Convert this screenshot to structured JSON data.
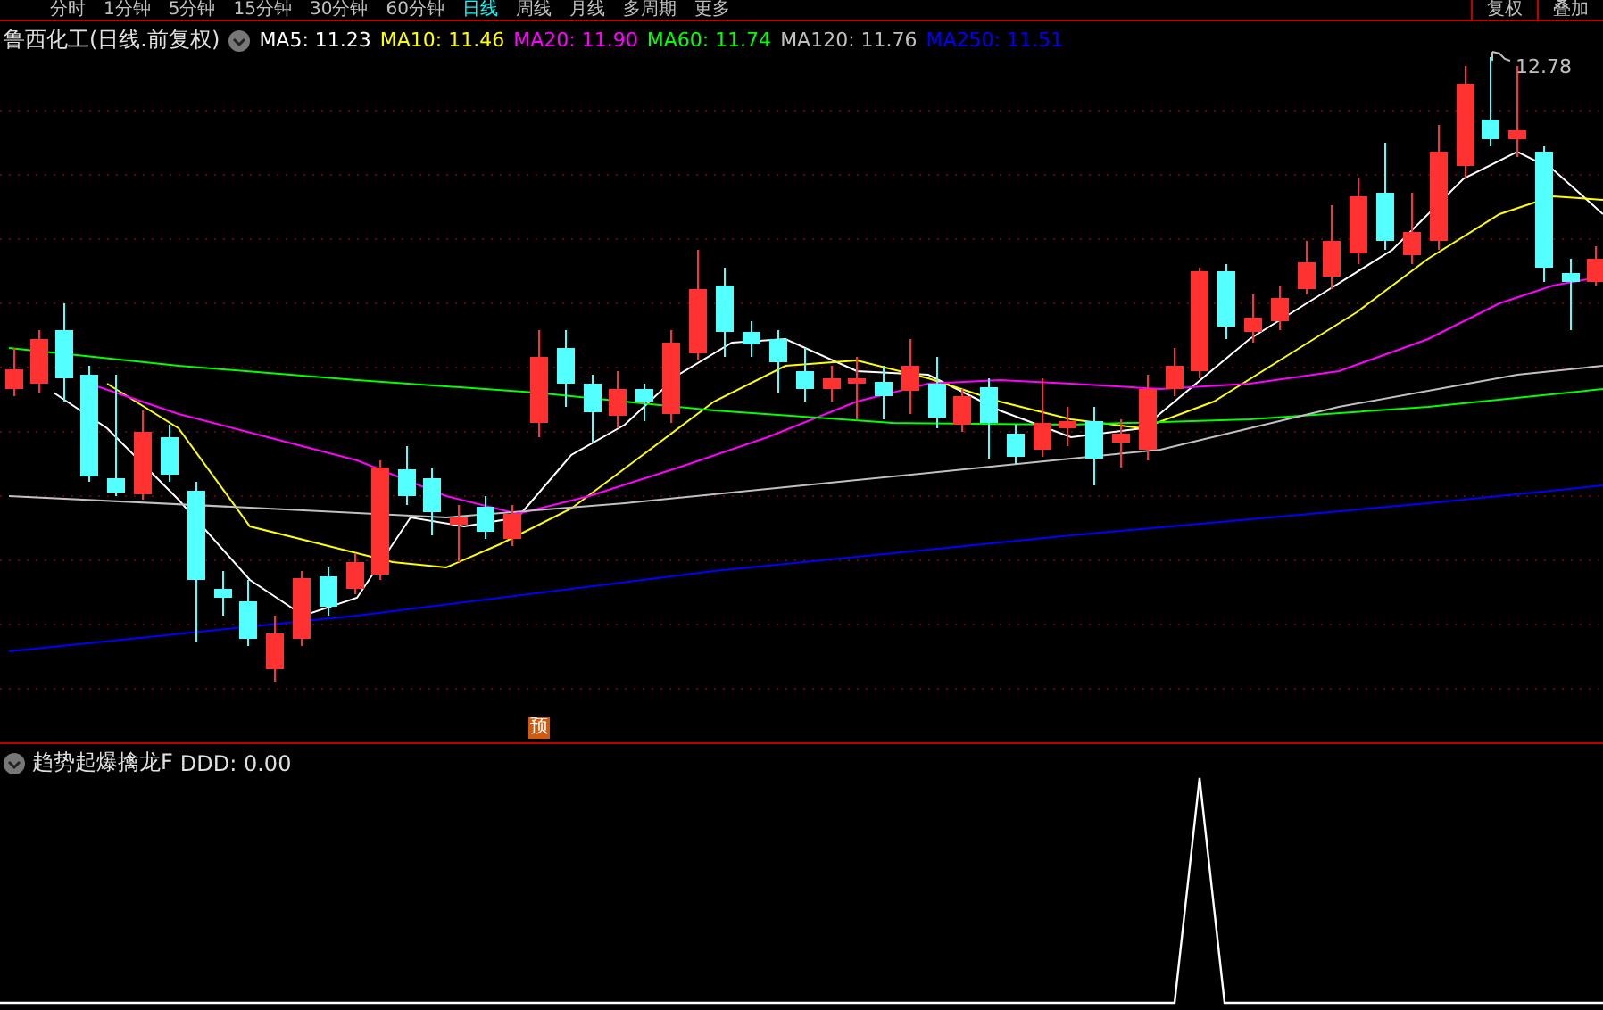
{
  "toolbar": {
    "tabs": [
      {
        "label": "分时",
        "selected": false
      },
      {
        "label": "1分钟",
        "selected": false
      },
      {
        "label": "5分钟",
        "selected": false
      },
      {
        "label": "15分钟",
        "selected": false
      },
      {
        "label": "30分钟",
        "selected": false
      },
      {
        "label": "60分钟",
        "selected": false
      },
      {
        "label": "日线",
        "selected": true
      },
      {
        "label": "周线",
        "selected": false
      },
      {
        "label": "月线",
        "selected": false
      },
      {
        "label": "多周期",
        "selected": false
      },
      {
        "label": "更多",
        "selected": false
      }
    ],
    "buttons": [
      "复权",
      "叠加"
    ]
  },
  "main_chart": {
    "title": "鲁西化工(日线.前复权)",
    "legend": [
      {
        "label": "MA5:",
        "value": "11.23",
        "color": "#ffffff"
      },
      {
        "label": "MA10:",
        "value": "11.46",
        "color": "#ffff00"
      },
      {
        "label": "MA20:",
        "value": "11.90",
        "color": "#ff00ff"
      },
      {
        "label": "MA60:",
        "value": "11.74",
        "color": "#00ff00"
      },
      {
        "label": "MA120:",
        "value": "11.76",
        "color": "#c0c0c0"
      },
      {
        "label": "MA250:",
        "value": "11.51",
        "color": "#0000ff"
      }
    ],
    "high_label": "12.78",
    "marker": "预"
  },
  "indicator": {
    "title": "趋势起爆擒龙F",
    "reading": "DDD: 0.00"
  }
}
